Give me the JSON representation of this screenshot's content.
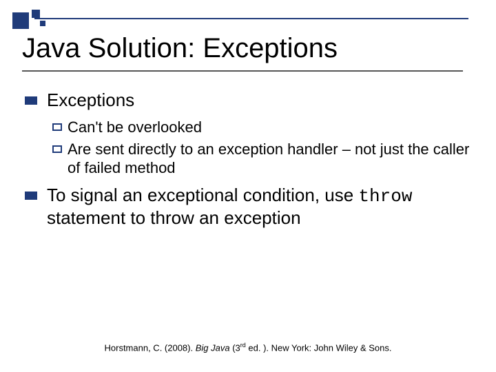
{
  "title": "Java Solution: Exceptions",
  "bullets": [
    {
      "text": "Exceptions",
      "sub": [
        {
          "prefix": "Can't",
          "rest": " be overlooked"
        },
        {
          "prefix": "Are",
          "rest": " sent directly to an exception handler – not just the caller of failed method"
        }
      ]
    },
    {
      "pre": "To signal an exceptional condition, use ",
      "code": "throw",
      "post": " statement to throw an exception"
    }
  ],
  "citation": {
    "author": "Horstmann, C. (2008). ",
    "title": "Big Java",
    "edition_open": " (3",
    "edition_sup": "rd",
    "edition_close": " ed. ). New York: John Wiley & Sons."
  }
}
